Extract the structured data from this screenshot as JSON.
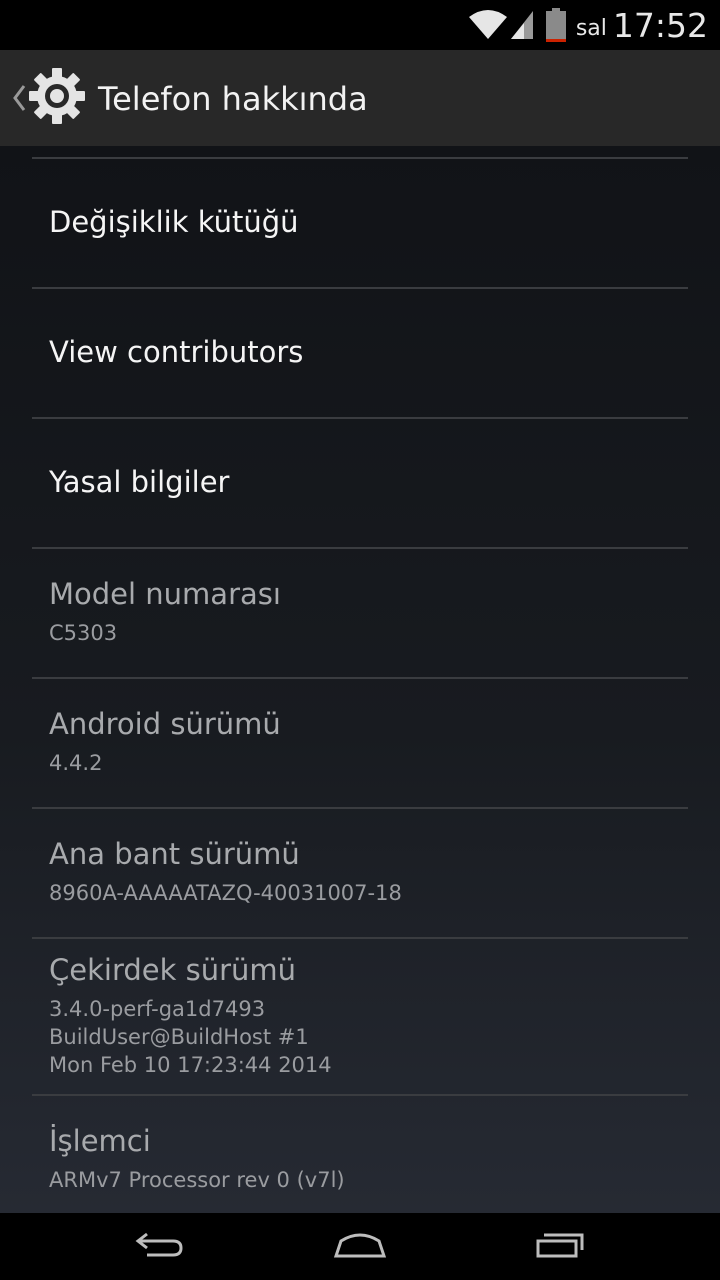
{
  "status_bar": {
    "day": "sal",
    "time": "17:52",
    "icons": [
      "wifi-icon",
      "signal-icon",
      "battery-icon"
    ],
    "battery_level": 0.1
  },
  "action_bar": {
    "title": "Telefon hakkında",
    "icons": [
      "back-chevron-icon",
      "settings-gear-icon"
    ]
  },
  "items": [
    {
      "title": "Değişiklik kütüğü"
    },
    {
      "title": "View contributors"
    },
    {
      "title": "Yasal bilgiler"
    },
    {
      "title": "Model numarası",
      "summary": [
        "C5303"
      ]
    },
    {
      "title": "Android sürümü",
      "summary": [
        "4.4.2"
      ]
    },
    {
      "title": "Ana bant sürümü",
      "summary": [
        "8960A-AAAAATAZQ-40031007-18"
      ]
    },
    {
      "title": "Çekirdek sürümü",
      "summary": [
        "3.4.0-perf-ga1d7493",
        "BuildUser@BuildHost #1",
        "Mon Feb 10 17:23:44 2014"
      ]
    },
    {
      "title": "İşlemci",
      "summary": [
        "ARMv7 Processor rev 0 (v7l)"
      ]
    }
  ],
  "nav_bar": {
    "buttons": [
      "back-icon",
      "home-icon",
      "recents-icon"
    ]
  },
  "colors": {
    "action_bar_bg": "#282828",
    "content_bg": "#111317",
    "battery_low": "#cc2200"
  }
}
